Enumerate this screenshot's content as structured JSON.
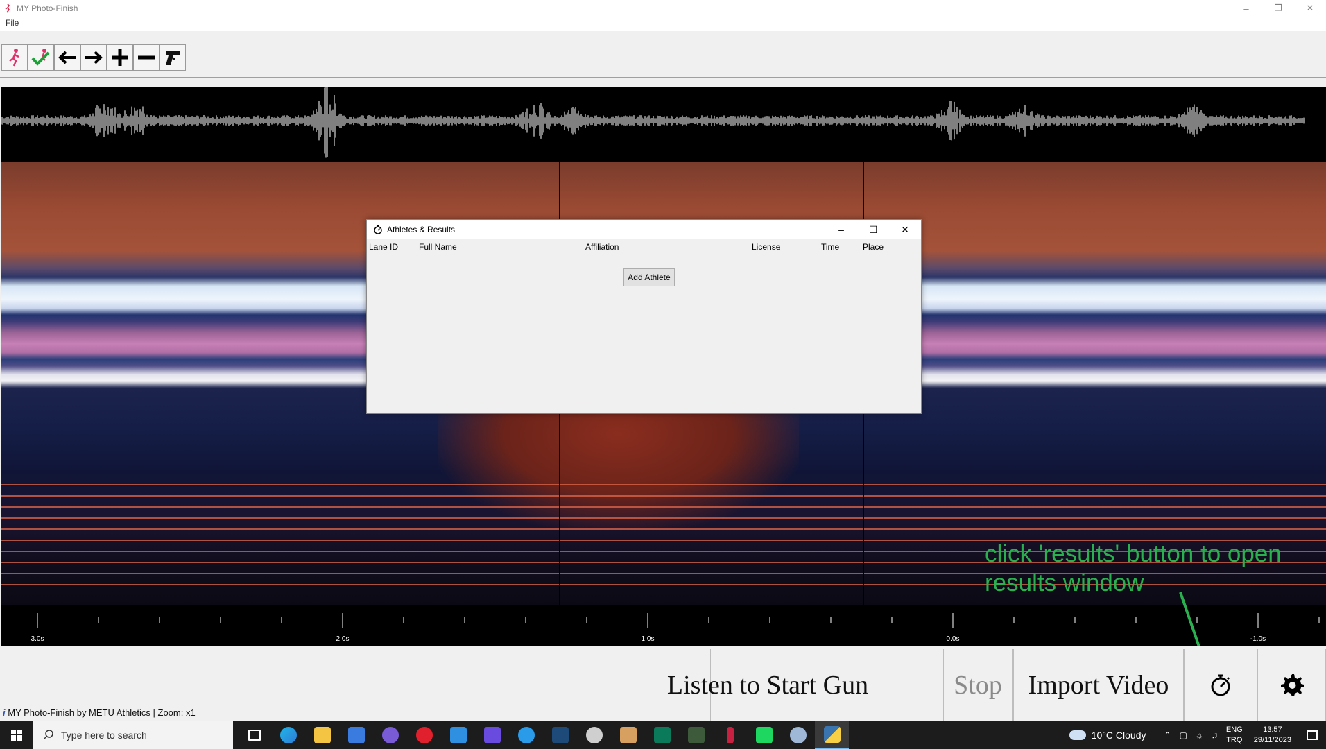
{
  "window": {
    "title": "MY Photo-Finish",
    "controls": [
      "minimize-icon",
      "restore-icon",
      "close-icon"
    ]
  },
  "menu": {
    "file": "File"
  },
  "toolbar": {
    "buttons": [
      "runner-icon",
      "runner-check-icon",
      "arrow-left-icon",
      "arrow-right-icon",
      "plus-icon",
      "minus-icon",
      "starter-gun-icon"
    ]
  },
  "timeline": {
    "labels": [
      "3.0s",
      "2.0s",
      "1.0s",
      "0.0s",
      "-1.0s"
    ]
  },
  "dialog": {
    "title": "Athletes & Results",
    "columns": {
      "lane_id": "Lane ID",
      "full_name": "Full Name",
      "affiliation": "Affiliation",
      "license": "License",
      "time": "Time",
      "place": "Place"
    },
    "add_button": "Add Athlete"
  },
  "controls": {
    "listen": "Listen to Start Gun",
    "stop": "Stop",
    "import": "Import Video",
    "results_icon": "stopwatch-icon",
    "settings_icon": "gear-icon"
  },
  "status": "MY Photo-Finish by METU Athletics | Zoom: x1",
  "annotation": "click 'results' button to open results window",
  "annotation_color": "#2ab04f",
  "taskbar": {
    "search_placeholder": "Type here to search",
    "weather": "10°C  Cloudy",
    "lang_top": "ENG",
    "lang_bottom": "TRQ",
    "time": "13:57",
    "date": "29/11/2023"
  }
}
